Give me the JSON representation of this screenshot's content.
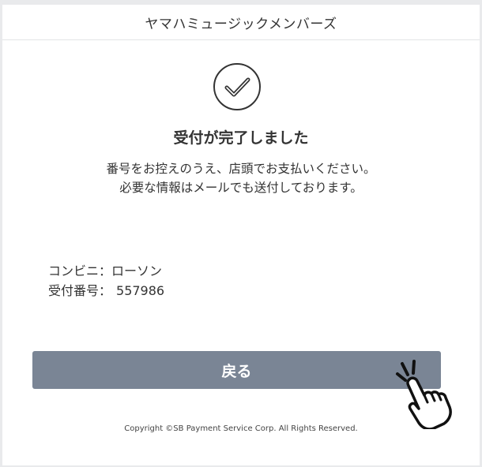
{
  "header": {
    "title": "ヤマハミュージックメンバーズ"
  },
  "main": {
    "title": "受付が完了しました",
    "message_line1": "番号をお控えのうえ、店頭でお支払いください。",
    "message_line2": "必要な情報はメールでも送付しております。",
    "details": {
      "store_label": "コンビニ：",
      "store_value": "ローソン",
      "number_label": "受付番号：",
      "number_value": "557986"
    },
    "back_button_label": "戻る"
  },
  "footer": {
    "copyright": "Copyright ©SB Payment Service Corp. All Rights Reserved."
  },
  "icons": {
    "check": "check-circle-icon",
    "cursor": "pointer-hand-icon"
  },
  "colors": {
    "button": "#7a8595",
    "text": "#333333",
    "background": "#e9eaec"
  }
}
